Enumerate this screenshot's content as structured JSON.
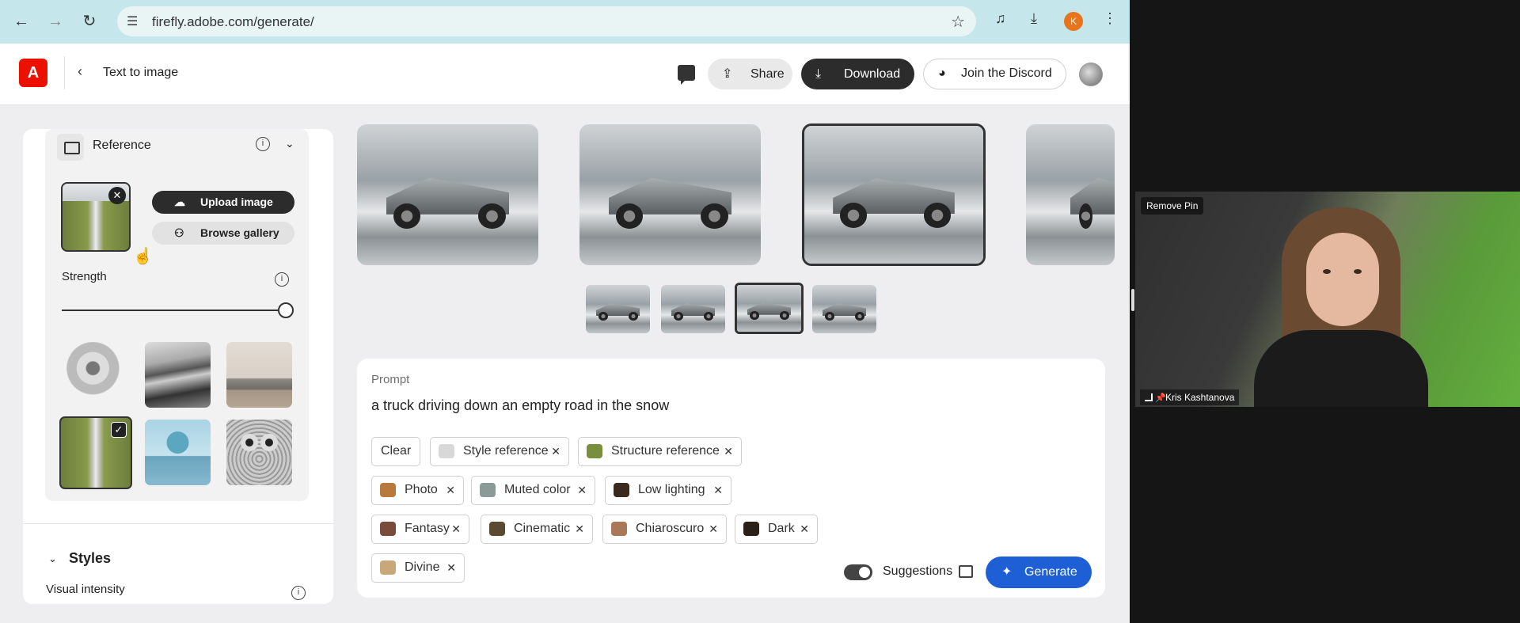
{
  "browser": {
    "url": "firefly.adobe.com/generate/",
    "profile_initial": "K",
    "nav_icons": [
      "back-arrow",
      "forward-arrow",
      "reload"
    ]
  },
  "header": {
    "logo_letter": "A",
    "back_glyph": "‹",
    "title": "Text to image",
    "share_label": "Share",
    "download_label": "Download",
    "discord_label": "Join the Discord"
  },
  "reference": {
    "title": "Reference",
    "upload_label": "Upload image",
    "browse_label": "Browse gallery",
    "strength_label": "Strength",
    "strength_value": 1.0,
    "selected_thumbnail_index": 3
  },
  "styles": {
    "title": "Styles",
    "visual_intensity_label": "Visual intensity"
  },
  "results": {
    "selected_index": 2,
    "count": 4
  },
  "prompt": {
    "label": "Prompt",
    "text": "a truck driving down an empty road in the snow",
    "clear_label": "Clear",
    "tags": [
      {
        "label": "Style reference",
        "swatch": "#d8d8d8"
      },
      {
        "label": "Structure reference",
        "swatch": "#7a8f3e"
      },
      {
        "label": "Photo",
        "swatch": "#b87a3c"
      },
      {
        "label": "Muted color",
        "swatch": "#8a9a96"
      },
      {
        "label": "Low lighting",
        "swatch": "#3a2a1e"
      },
      {
        "label": "Fantasy",
        "swatch": "#7a4a3a"
      },
      {
        "label": "Cinematic",
        "swatch": "#5a4a30"
      },
      {
        "label": "Chiaroscuro",
        "swatch": "#a87858"
      },
      {
        "label": "Dark",
        "swatch": "#2a2018"
      },
      {
        "label": "Divine",
        "swatch": "#c8a878"
      }
    ],
    "suggestions_label": "Suggestions",
    "suggestions_on": true,
    "generate_label": "Generate"
  },
  "video": {
    "remove_pin_label": "Remove Pin",
    "participant_name": "Kris Kashtanova"
  },
  "colors": {
    "accent": "#1e5fd6",
    "brand": "#eb1000",
    "chrome": "#c5e6ea"
  }
}
